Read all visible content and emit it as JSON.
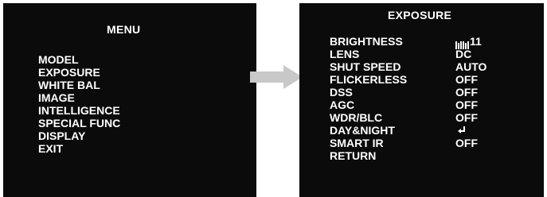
{
  "menu": {
    "title": "MENU",
    "items": [
      "MODEL",
      "EXPOSURE",
      "WHITE BAL",
      "IMAGE",
      "INTELLIGENCE",
      "SPECIAL FUNC",
      "DISPLAY",
      "EXIT"
    ]
  },
  "exposure": {
    "title": "EXPOSURE",
    "rows": [
      {
        "label": "BRIGHTNESS",
        "value": "11",
        "level": 11
      },
      {
        "label": "LENS",
        "value": "DC"
      },
      {
        "label": "SHUT SPEED",
        "value": "AUTO"
      },
      {
        "label": "FLICKERLESS",
        "value": "OFF"
      },
      {
        "label": "DSS",
        "value": "OFF"
      },
      {
        "label": "AGC",
        "value": "OFF"
      },
      {
        "label": "WDR/BLC",
        "value": "OFF"
      },
      {
        "label": "DAY&NIGHT",
        "value": "",
        "icon": "enter-submenu-icon"
      },
      {
        "label": "SMART IR",
        "value": "OFF"
      },
      {
        "label": "RETURN",
        "value": ""
      }
    ]
  },
  "colors": {
    "screen_bg": "#0b0b0b",
    "text": "#ffffff",
    "arrow": "#c8c8c8"
  }
}
